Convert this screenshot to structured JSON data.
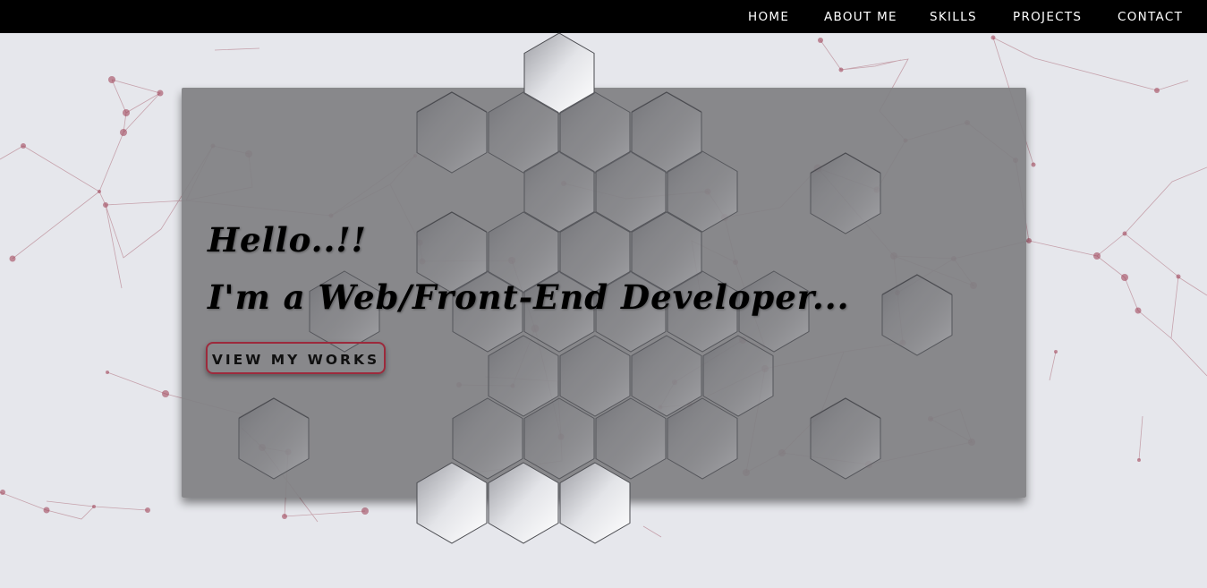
{
  "nav": {
    "items": [
      {
        "label": "HOME"
      },
      {
        "label": "ABOUT ME"
      },
      {
        "label": "SKILLS"
      },
      {
        "label": "PROJECTS"
      },
      {
        "label": "CONTACT"
      }
    ]
  },
  "hero": {
    "greeting": "Hello..!!",
    "tagline": "I'm a Web/Front-End Developer...",
    "cta_label": "VIEW MY WORKS"
  },
  "colors": {
    "nav_background": "#000000",
    "page_background": "#e6e7ec",
    "card_background": "#808083",
    "accent": "#9c2a3c",
    "network_line": "#a05060"
  }
}
